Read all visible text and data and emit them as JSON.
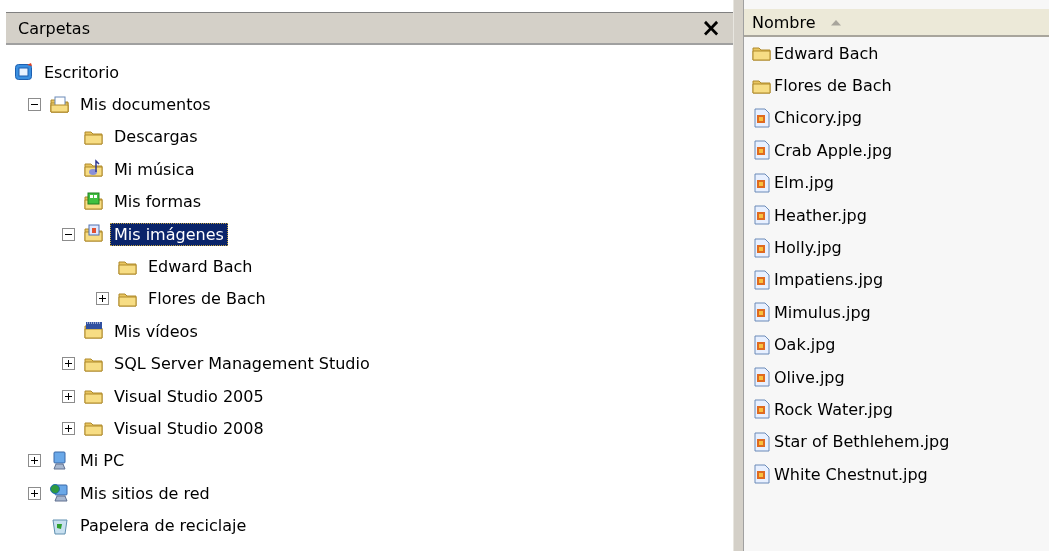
{
  "folders_pane": {
    "title": "Carpetas",
    "close": "×"
  },
  "tree": [
    {
      "label": "Escritorio",
      "kind": "desktop",
      "selected": false,
      "children": [
        {
          "label": "Mis documentos",
          "kind": "documents",
          "expanded": true,
          "selected": false,
          "children": [
            {
              "label": "Descargas",
              "kind": "folder",
              "selected": false
            },
            {
              "label": "Mi música",
              "kind": "music",
              "selected": false
            },
            {
              "label": "Mis formas",
              "kind": "forms",
              "selected": false
            },
            {
              "label": "Mis imágenes",
              "kind": "pictures",
              "expanded": true,
              "selected": true,
              "children": [
                {
                  "label": "Edward Bach",
                  "kind": "folder",
                  "selected": false
                },
                {
                  "label": "Flores de Bach",
                  "kind": "folder",
                  "expanded": false,
                  "selected": false
                }
              ]
            },
            {
              "label": "Mis vídeos",
              "kind": "videos",
              "selected": false
            },
            {
              "label": "SQL Server Management Studio",
              "kind": "folder",
              "expanded": false,
              "selected": false
            },
            {
              "label": "Visual Studio 2005",
              "kind": "folder",
              "expanded": false,
              "selected": false
            },
            {
              "label": "Visual Studio 2008",
              "kind": "folder",
              "expanded": false,
              "selected": false
            }
          ]
        },
        {
          "label": "Mi PC",
          "kind": "computer",
          "expanded": false,
          "selected": false
        },
        {
          "label": "Mis sitios de red",
          "kind": "network",
          "expanded": false,
          "selected": false
        },
        {
          "label": "Papelera de reciclaje",
          "kind": "recycle",
          "selected": false
        }
      ]
    }
  ],
  "file_list": {
    "column": "Nombre",
    "sort_ascending": true,
    "items": [
      {
        "name": "Edward Bach",
        "kind": "folder"
      },
      {
        "name": "Flores de Bach",
        "kind": "folder"
      },
      {
        "name": "Chicory.jpg",
        "kind": "image"
      },
      {
        "name": "Crab Apple.jpg",
        "kind": "image"
      },
      {
        "name": "Elm.jpg",
        "kind": "image"
      },
      {
        "name": "Heather.jpg",
        "kind": "image"
      },
      {
        "name": "Holly.jpg",
        "kind": "image"
      },
      {
        "name": "Impatiens.jpg",
        "kind": "image"
      },
      {
        "name": "Mimulus.jpg",
        "kind": "image"
      },
      {
        "name": "Oak.jpg",
        "kind": "image"
      },
      {
        "name": "Olive.jpg",
        "kind": "image"
      },
      {
        "name": "Rock Water.jpg",
        "kind": "image"
      },
      {
        "name": "Star of Bethlehem.jpg",
        "kind": "image"
      },
      {
        "name": "White Chestnut.jpg",
        "kind": "image"
      }
    ]
  }
}
